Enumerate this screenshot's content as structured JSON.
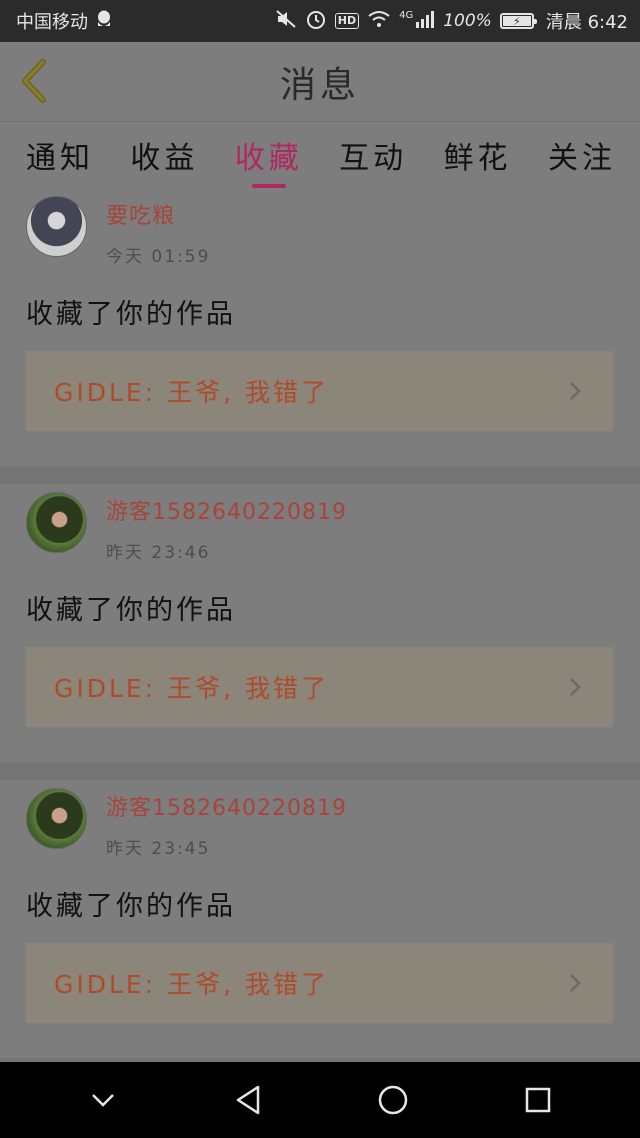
{
  "status_bar": {
    "carrier": "中国移动",
    "network": "4G",
    "battery": "100%",
    "time": "清晨 6:42",
    "icons": [
      "qq-icon",
      "mute-icon",
      "alarm-icon",
      "hd-icon",
      "wifi-icon",
      "signal-icon",
      "battery-icon"
    ]
  },
  "header": {
    "title": "消息"
  },
  "tabs": [
    {
      "label": "通知",
      "active": false
    },
    {
      "label": "收益",
      "active": false
    },
    {
      "label": "收藏",
      "active": true
    },
    {
      "label": "互动",
      "active": false
    },
    {
      "label": "鲜花",
      "active": false
    },
    {
      "label": "关注",
      "active": false
    }
  ],
  "items": [
    {
      "username": "要吃粮",
      "time": "今天 01:59",
      "action": "收藏了你的作品",
      "work": "GIDLE: 王爷, 我错了"
    },
    {
      "username": "游客1582640220819",
      "time": "昨天 23:46",
      "action": "收藏了你的作品",
      "work": "GIDLE: 王爷, 我错了"
    },
    {
      "username": "游客1582640220819",
      "time": "昨天 23:45",
      "action": "收藏了你的作品",
      "work": "GIDLE: 王爷, 我错了"
    }
  ],
  "colors": {
    "accent": "#b0285f",
    "username": "#a8443a",
    "work_title": "#b04a2a"
  }
}
